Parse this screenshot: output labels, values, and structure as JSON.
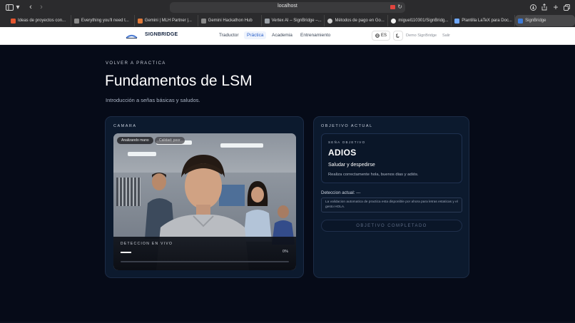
{
  "browser": {
    "url": "localhost",
    "tabs": [
      {
        "label": "Ideas de proyectos con...",
        "color": "#e4562f",
        "active": false
      },
      {
        "label": "Everything you'll need t...",
        "color": "#8a8a8a",
        "active": false
      },
      {
        "label": "Gemini | MLH Partner |...",
        "color": "#e07a3a",
        "active": false
      },
      {
        "label": "Gemini Hackathon Hub",
        "color": "#8a8a8a",
        "active": false
      },
      {
        "label": "Vertex AI – SignBridge –...",
        "color": "#9aa0a6",
        "active": false
      },
      {
        "label": "Métodos de pago en Go...",
        "color": "#cfcfcf",
        "active": false
      },
      {
        "label": "miguel110301/SignBridg...",
        "color": "#f2f2f2",
        "active": false
      },
      {
        "label": "Plantilla LaTeX para Doc...",
        "color": "#6fa8ff",
        "active": false
      },
      {
        "label": "SignBridge",
        "color": "#3d7bd9",
        "active": true
      }
    ]
  },
  "nav": {
    "brand": "SIGNBRIDGE",
    "links": [
      "Traductor",
      "Práctica",
      "Academia",
      "Entrenamiento"
    ],
    "active_link": "Práctica",
    "lang": "ES",
    "user": "Demo SignBridge",
    "logout": "Salir"
  },
  "page": {
    "back": "VOLVER A PRACTICA",
    "title": "Fundamentos de LSM",
    "subtitle": "Introducción a señas básicas y saludos."
  },
  "camera": {
    "label": "CAMARA",
    "badge_status": "Analizando mano",
    "badge_quality": "Calidad: poor",
    "detection_label": "DETECCION EN VIVO",
    "detection_value": "---",
    "confidence": "0%"
  },
  "objective": {
    "label": "OBJETIVO ACTUAL",
    "sign_label": "SEÑA OBJETIVO",
    "sign": "ADIOS",
    "sign_title": "Saludar y despedirse",
    "sign_desc": "Realiza correctamente hola, buenos dias y adiós.",
    "current_label": "Deteccion actual:",
    "current_value": "---",
    "note": "La validacion automatica de practica esta disponible por ahora para letras estaticas y el gesto HOLA.",
    "complete_button": "OBJETIVO COMPLETADO"
  },
  "colors": {
    "accent": "#2a60c8",
    "background": "#060b18",
    "card": "#0c1a2e"
  }
}
